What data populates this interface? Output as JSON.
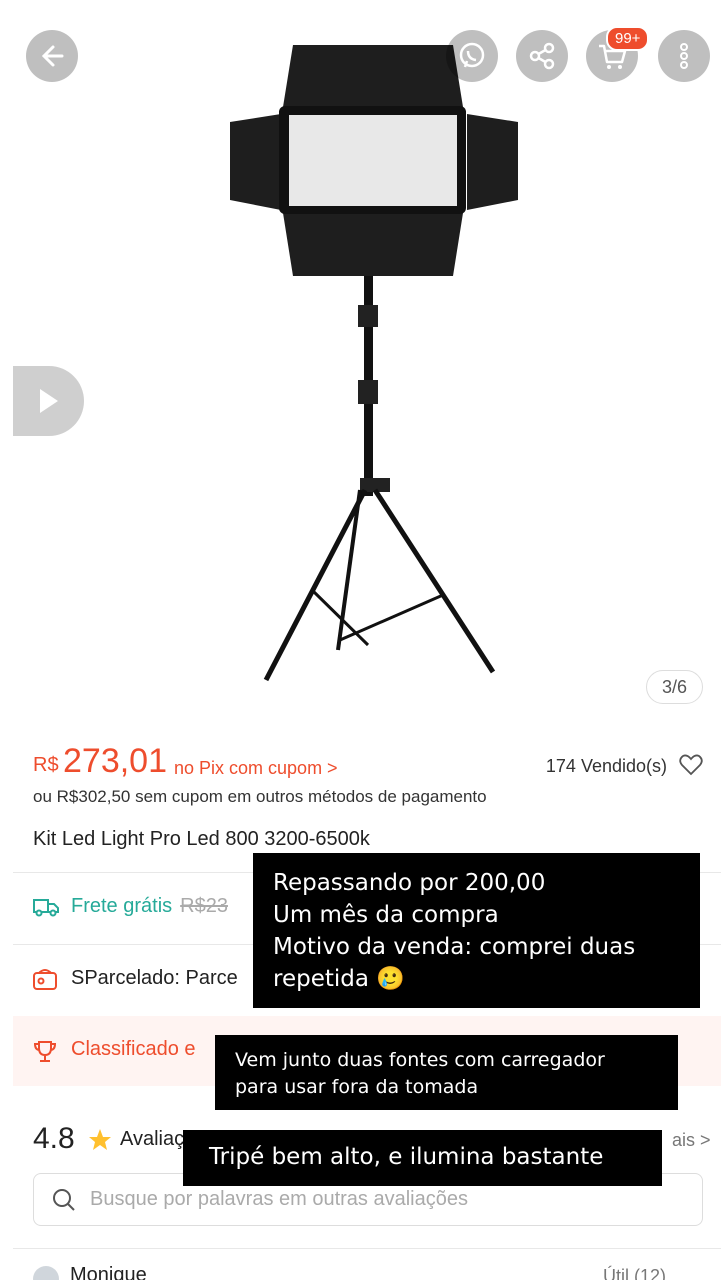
{
  "header": {
    "cart_badge": "99+",
    "icons": [
      "back-arrow-icon",
      "whatsapp-icon",
      "share-icon",
      "cart-icon",
      "more-icon"
    ]
  },
  "gallery": {
    "counter": "3/6"
  },
  "price": {
    "currency": "R$",
    "amount": "273,01",
    "pix_label": "no Pix com cupom >",
    "sold": "174 Vendido(s)",
    "alt_price": "ou R$302,50 sem cupom em outros métodos de pagamento"
  },
  "product": {
    "title": "Kit Led Light Pro Led 800 3200-6500k"
  },
  "shipping": {
    "label": "Frete grátis",
    "old_price": "R$23"
  },
  "installments": {
    "label": "SParcelado: Parce"
  },
  "classified": {
    "label": "Classificado e"
  },
  "reviews": {
    "rating": "4.8",
    "label": "Avaliaç",
    "more": "ais >",
    "search_placeholder": "Busque por palavras em outras avaliações",
    "reviewer": "Monique",
    "util": "Útil (12)"
  },
  "overlays": {
    "box1": [
      "Repassando por 200,00",
      "Um mês da compra",
      "Motivo da venda: comprei duas",
      "repetida 🥲"
    ],
    "box2": [
      "Vem junto duas fontes com carregador",
      "para usar fora da tomada"
    ],
    "box3": "Tripé bem alto, e ilumina bastante"
  },
  "colors": {
    "accent": "#ee4d2d",
    "shipping": "#26aa99"
  }
}
